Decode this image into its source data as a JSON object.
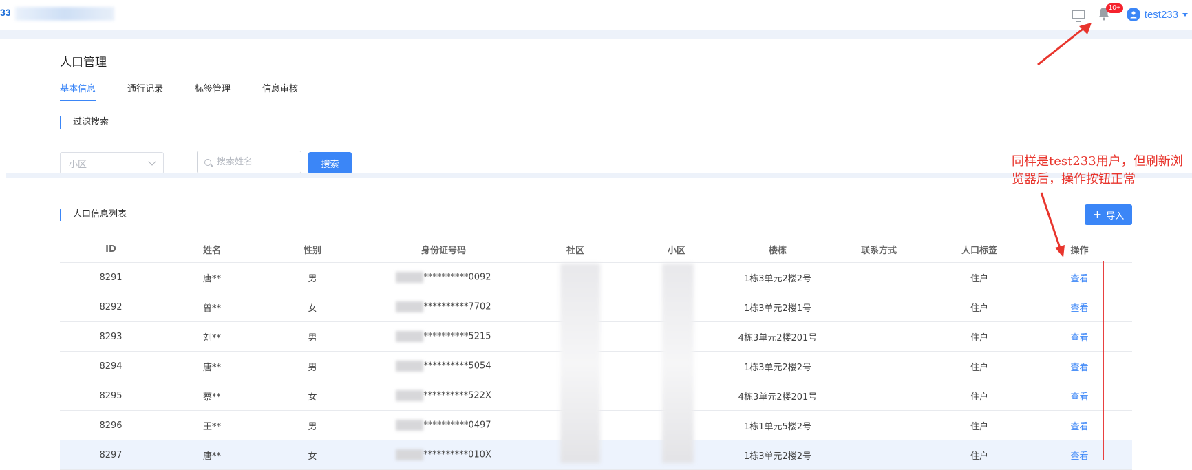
{
  "header": {
    "app_title": "33",
    "notification_badge": "10+",
    "username": "test233",
    "icons": [
      "monitor-icon",
      "bell-icon",
      "user-avatar-icon",
      "caret-down-icon"
    ]
  },
  "page": {
    "title": "人口管理",
    "tabs": [
      {
        "label": "基本信息",
        "active": true
      },
      {
        "label": "通行记录",
        "active": false
      },
      {
        "label": "标签管理",
        "active": false
      },
      {
        "label": "信息审核",
        "active": false
      }
    ]
  },
  "filter": {
    "section_title": "过滤搜索",
    "community_select_placeholder": "小区",
    "search_placeholder": "搜索姓名",
    "search_button": "搜索"
  },
  "list": {
    "section_title": "人口信息列表",
    "import_button": "导入",
    "columns": [
      "ID",
      "姓名",
      "性别",
      "身份证号码",
      "社区",
      "小区",
      "楼栋",
      "联系方式",
      "人口标签",
      "操作"
    ],
    "rows": [
      {
        "id": "8291",
        "name": "唐**",
        "gender": "男",
        "id_card": "**********0092",
        "building": "1栋3单元2楼2号",
        "tag": "住户",
        "action": "查看",
        "highlighted": false
      },
      {
        "id": "8292",
        "name": "曾**",
        "gender": "女",
        "id_card": "**********7702",
        "building": "1栋3单元2楼1号",
        "tag": "住户",
        "action": "查看",
        "highlighted": false
      },
      {
        "id": "8293",
        "name": "刘**",
        "gender": "男",
        "id_card": "**********5215",
        "building": "4栋3单元2楼201号",
        "tag": "住户",
        "action": "查看",
        "highlighted": false
      },
      {
        "id": "8294",
        "name": "唐**",
        "gender": "男",
        "id_card": "**********5054",
        "building": "1栋3单元2楼2号",
        "tag": "住户",
        "action": "查看",
        "highlighted": false
      },
      {
        "id": "8295",
        "name": "蔡**",
        "gender": "女",
        "id_card": "**********522X",
        "building": "4栋3单元2楼201号",
        "tag": "住户",
        "action": "查看",
        "highlighted": false
      },
      {
        "id": "8296",
        "name": "王**",
        "gender": "男",
        "id_card": "**********0497",
        "building": "1栋1单元5楼2号",
        "tag": "住户",
        "action": "查看",
        "highlighted": false
      },
      {
        "id": "8297",
        "name": "唐**",
        "gender": "女",
        "id_card": "**********010X",
        "building": "1栋3单元2楼2号",
        "tag": "住户",
        "action": "查看",
        "highlighted": true
      }
    ]
  },
  "annotation": {
    "text": "同样是test233用户，但刷新浏览器后，操作按钮正常",
    "color": "#e8352d"
  },
  "colors": {
    "accent": "#3b86f7",
    "band": "#edf2fa",
    "annotation_red": "#e8352d"
  }
}
